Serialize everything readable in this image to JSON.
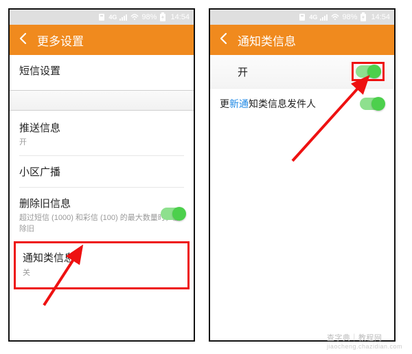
{
  "status": {
    "net_label": "4G",
    "battery_pct": "98%",
    "charging": true,
    "clock": "14:54"
  },
  "left": {
    "header_title": "更多设置",
    "item_sms": "短信设置",
    "item_push_title": "推送信息",
    "item_push_sub": "开",
    "item_cellbc": "小区广播",
    "item_delold_title": "删除旧信息",
    "item_delold_sub": "超过短信 (1000) 和彩信 (100) 的最大数量时，删除旧",
    "item_notice_title": "通知类信息",
    "item_notice_sub": "关"
  },
  "right": {
    "header_title": "通知类信息",
    "row_on_label": "开",
    "row_update_prefix": "更",
    "row_update_highlight": "新通",
    "row_update_rest": "知类信息发件人"
  },
  "watermark": {
    "line1": "查字典｜教程网",
    "line2": "jiaocheng.chazidian.com"
  }
}
